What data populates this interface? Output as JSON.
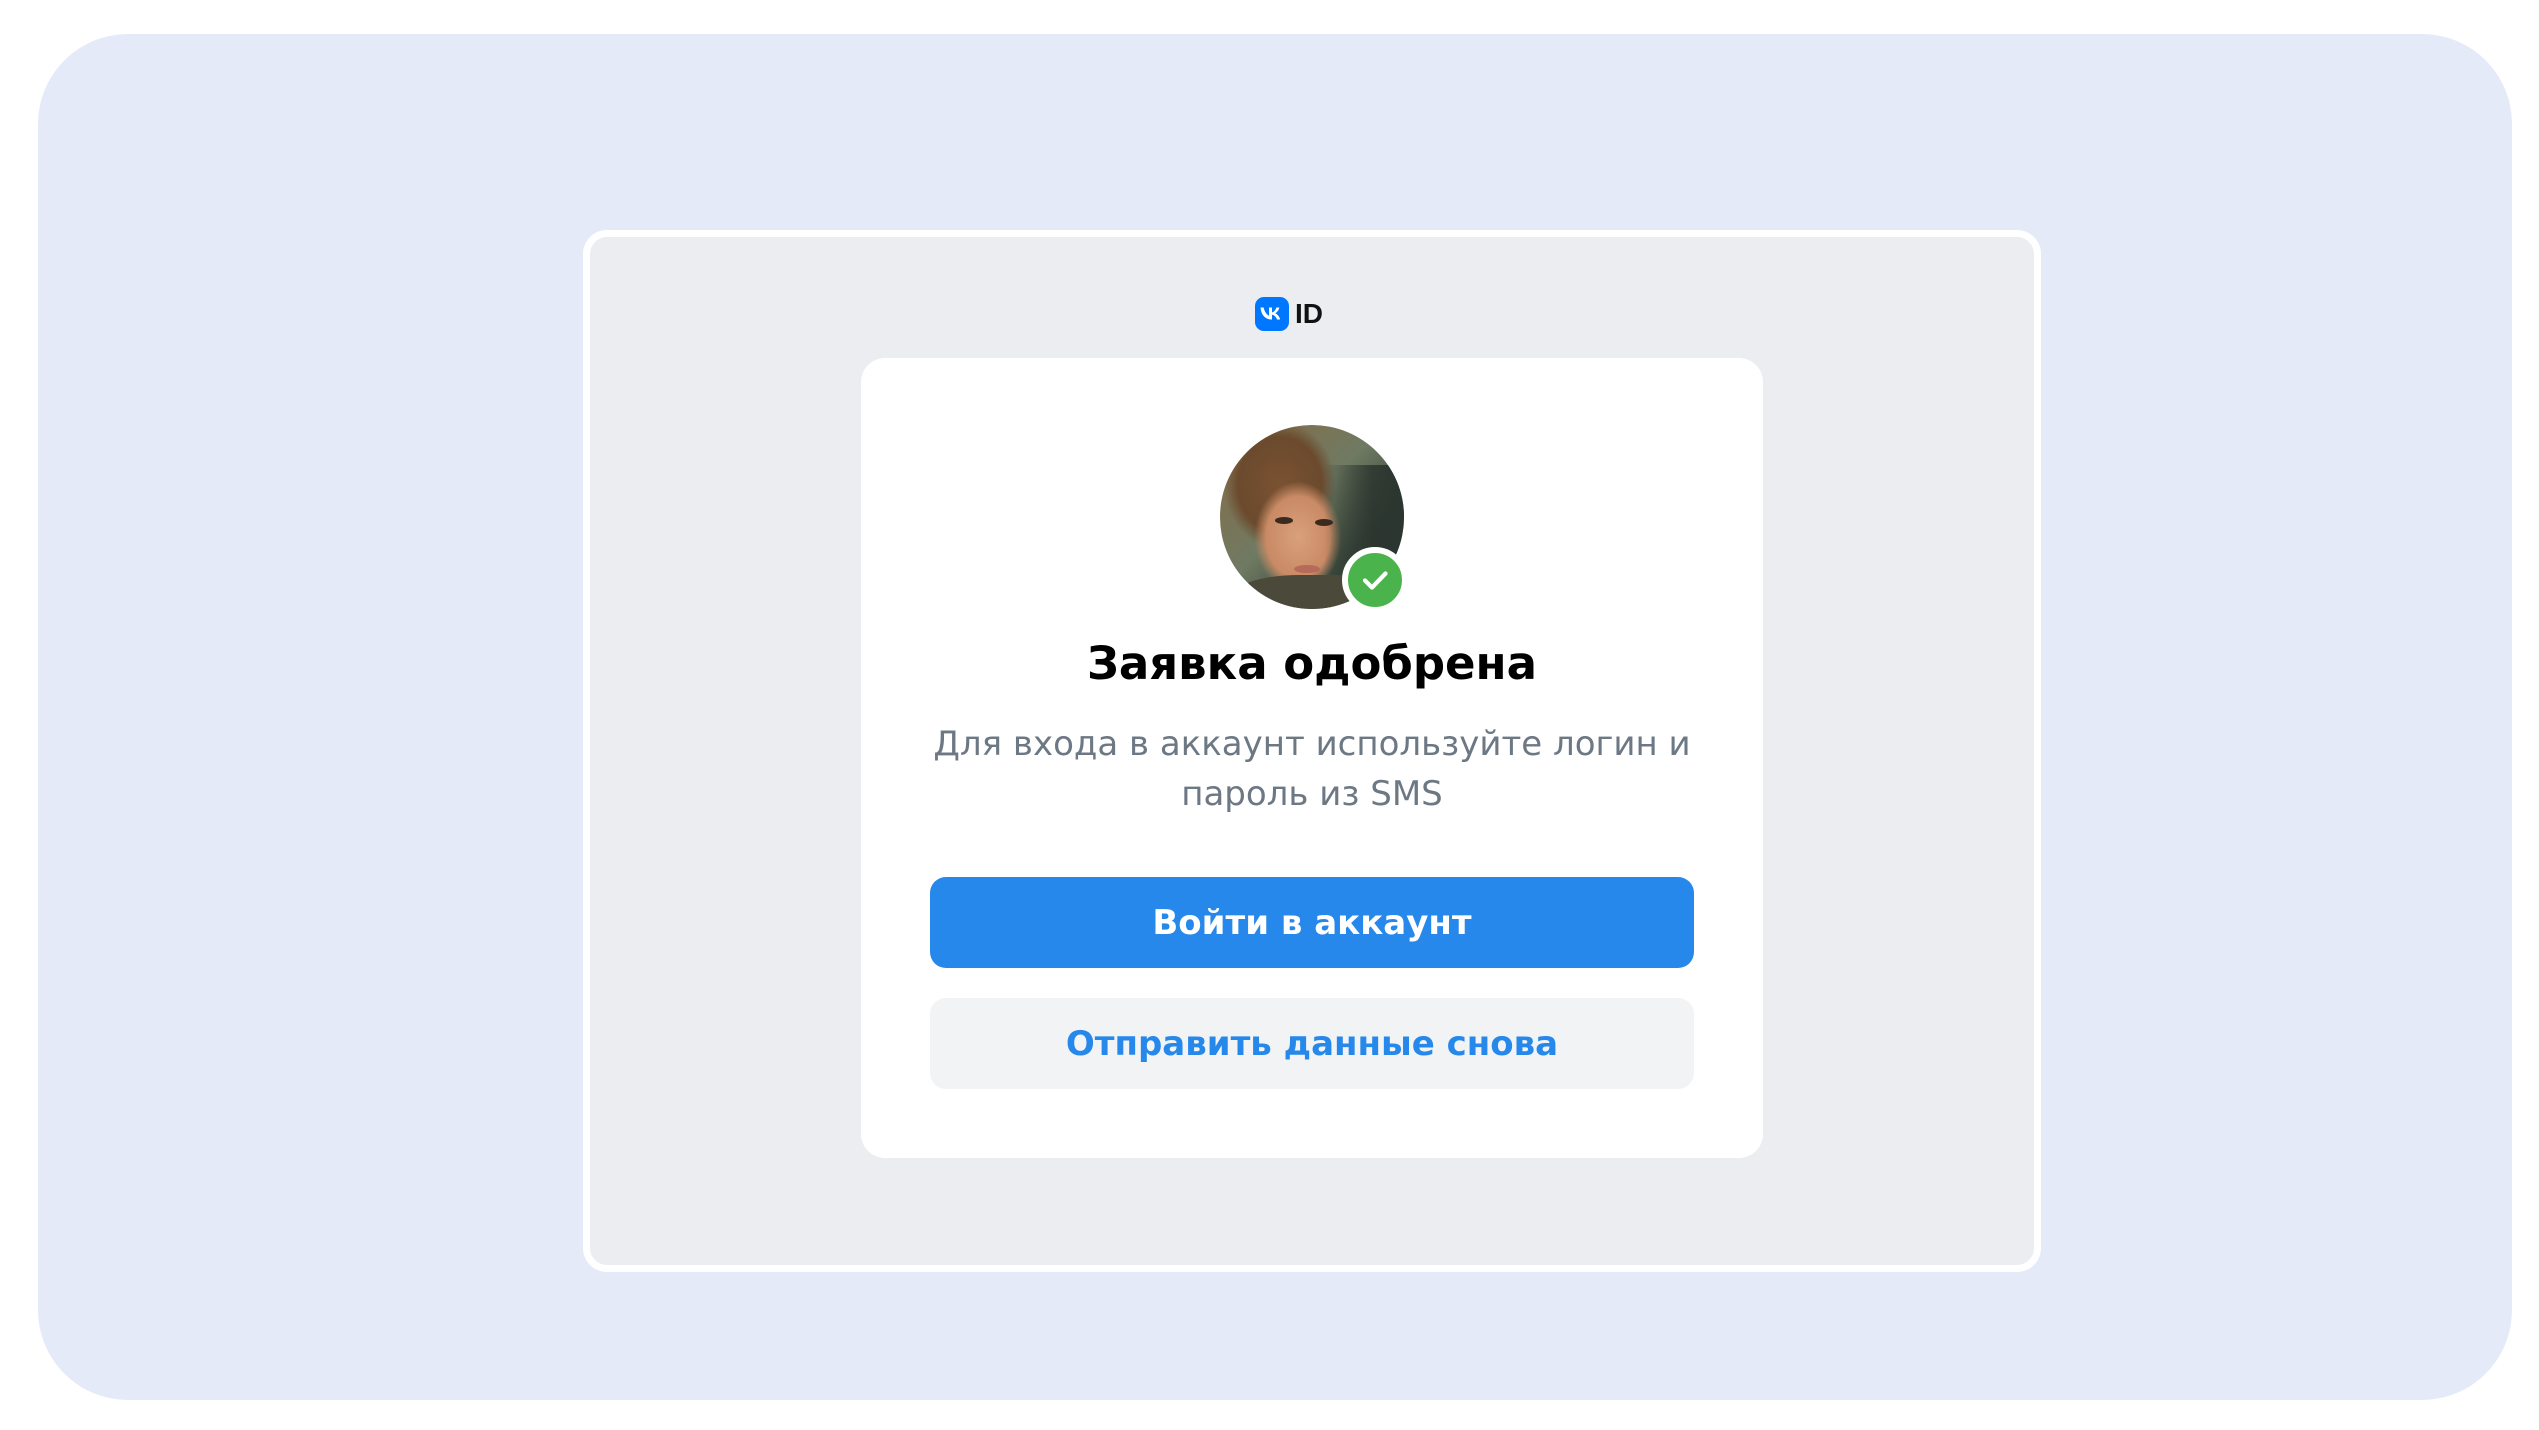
{
  "logo": {
    "badge_text": "VK",
    "id_text": "ID"
  },
  "card": {
    "avatar": {
      "image": "user-profile-photo",
      "status_icon": "checkmark-icon",
      "status_color": "#4bb34b"
    },
    "title": "Заявка одобрена",
    "subtitle": "Для входа в аккаунт используйте логин и пароль из SMS",
    "primary_button_label": "Войти в аккаунт",
    "secondary_button_label": "Отправить данные снова"
  },
  "colors": {
    "accent": "#2688eb",
    "vk_brand": "#0077ff",
    "secondary_text": "#6d7885",
    "page_background": "#e5eaf8",
    "frame_background": "#ebedf1"
  }
}
